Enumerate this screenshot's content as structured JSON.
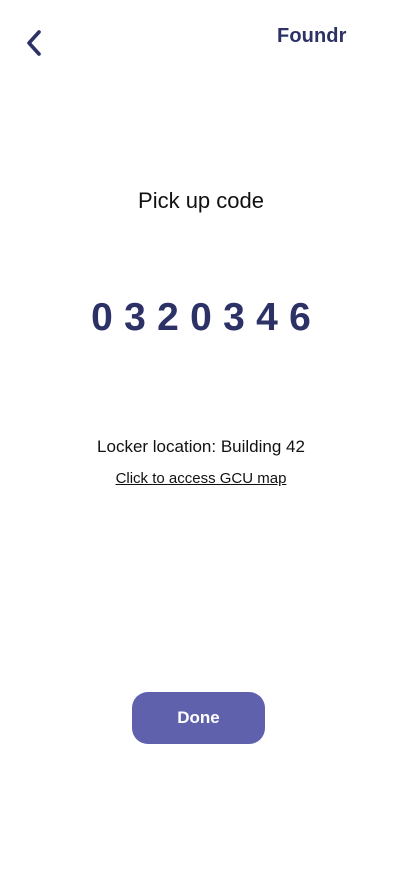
{
  "header": {
    "back_icon": "chevron-left-icon",
    "brand": "Foundr"
  },
  "main": {
    "title": "Pick up code",
    "code_digits": [
      "0",
      "3",
      "2",
      "0",
      "3",
      "4",
      "6"
    ],
    "locker_location": "Locker location: Building 42",
    "map_link": "Click to access GCU map"
  },
  "footer": {
    "done_label": "Done"
  },
  "colors": {
    "accent": "#2c3166",
    "button": "#6061ad",
    "background": "#ffffff"
  }
}
